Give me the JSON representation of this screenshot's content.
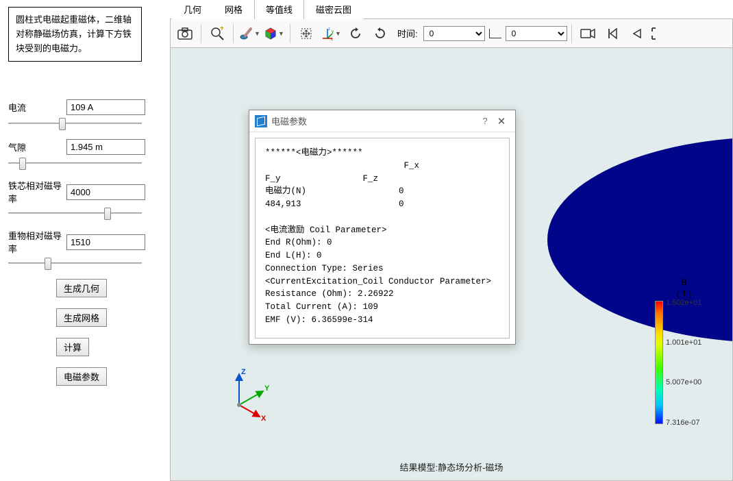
{
  "description": "圆柱式电磁起重磁体，二维轴对称静磁场仿真，计算下方铁块受到的电磁力。",
  "params": {
    "current": {
      "label": "电流",
      "value": "109 A",
      "thumb": 38
    },
    "gap": {
      "label": "气隙",
      "value": "1.945 m",
      "thumb": 8
    },
    "core": {
      "label": "铁芯相对磁导率",
      "value": "4000",
      "thumb": 72
    },
    "weight": {
      "label": "重物相对磁导率",
      "value": "1510",
      "thumb": 27
    }
  },
  "buttons": {
    "gen_geom": "生成几何",
    "gen_mesh": "生成网格",
    "compute": "计算",
    "em_params": "电磁参数"
  },
  "tabs": {
    "geom": "几何",
    "mesh": "网格",
    "contour": "等值线",
    "density": "磁密云图"
  },
  "toolbar": {
    "time_label": "时间:",
    "combo1": "0",
    "combo2": "0"
  },
  "legend": {
    "title1": "B",
    "title2": "( T )",
    "t0": "1.502e+01",
    "t1": "1.001e+01",
    "t2": "5.007e+00",
    "t3": "7.316e-07"
  },
  "footer": "结果模型:静态场分析-磁场",
  "dialog": {
    "title": "电磁参数",
    "body": "******<电磁力>******\n                           F_x           \nF_y                F_z\n电磁力(N)                  0             \n484,913                   0\n\n<电流激励 Coil Parameter>\nEnd R(Ohm): 0\nEnd L(H): 0\nConnection Type: Series\n<CurrentExcitation_Coil Conductor Parameter>\nResistance (Ohm): 2.26922\nTotal Current (A): 109\nEMF (V): 6.36599e-314"
  }
}
